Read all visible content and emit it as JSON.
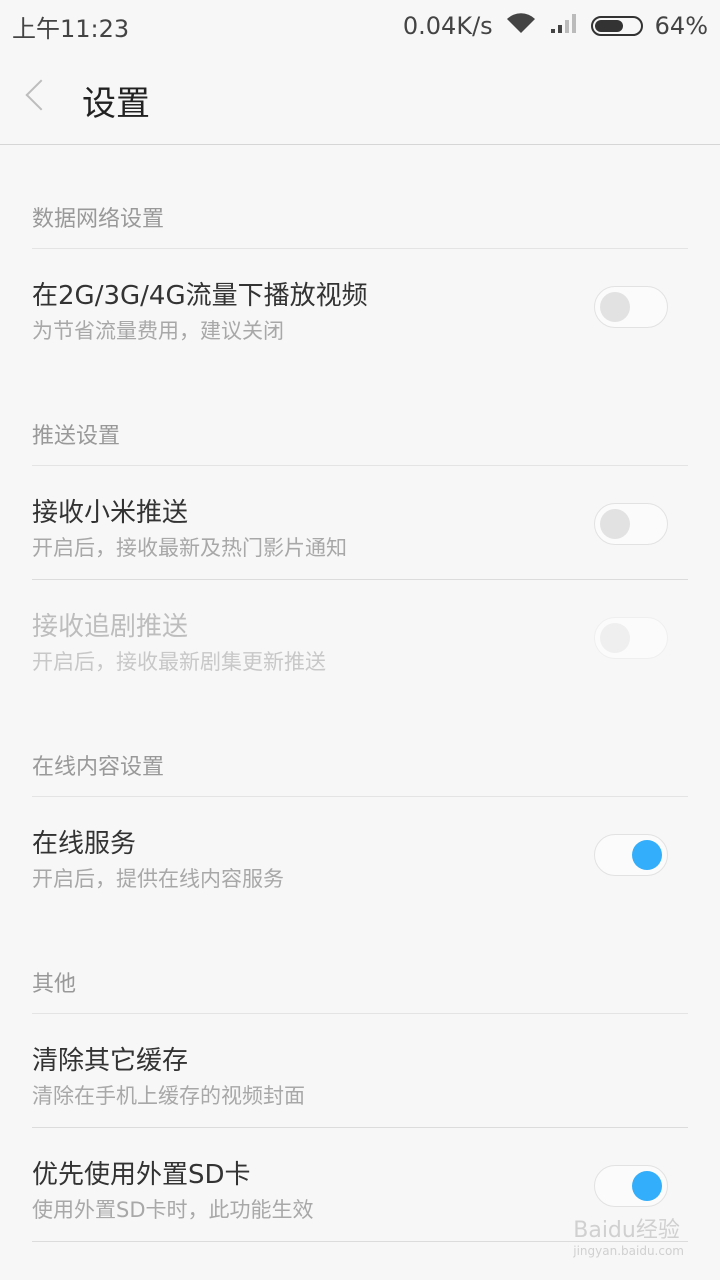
{
  "statusbar": {
    "time": "上午11:23",
    "network_speed": "0.04K/s",
    "battery": "64%",
    "battery_level": 0.64
  },
  "header": {
    "title": "设置"
  },
  "sections": [
    {
      "header": "数据网络设置",
      "rows": [
        {
          "title": "在2G/3G/4G流量下播放视频",
          "subtitle": "为节省流量费用，建议关闭",
          "toggle": "off"
        }
      ]
    },
    {
      "header": "推送设置",
      "rows": [
        {
          "title": "接收小米推送",
          "subtitle": "开启后，接收最新及热门影片通知",
          "toggle": "off"
        },
        {
          "title": "接收追剧推送",
          "subtitle": "开启后，接收最新剧集更新推送",
          "toggle": "disabled"
        }
      ]
    },
    {
      "header": "在线内容设置",
      "rows": [
        {
          "title": "在线服务",
          "subtitle": "开启后，提供在线内容服务",
          "toggle": "on"
        }
      ]
    },
    {
      "header": "其他",
      "rows": [
        {
          "title": "清除其它缓存",
          "subtitle": "清除在手机上缓存的视频封面"
        },
        {
          "title": "优先使用外置SD卡",
          "subtitle": "使用外置SD卡时，此功能生效",
          "toggle": "on"
        }
      ]
    }
  ],
  "watermark": {
    "text": "Baidu经验",
    "url": "jingyan.baidu.com"
  },
  "colors": {
    "accent": "#32aefb"
  }
}
